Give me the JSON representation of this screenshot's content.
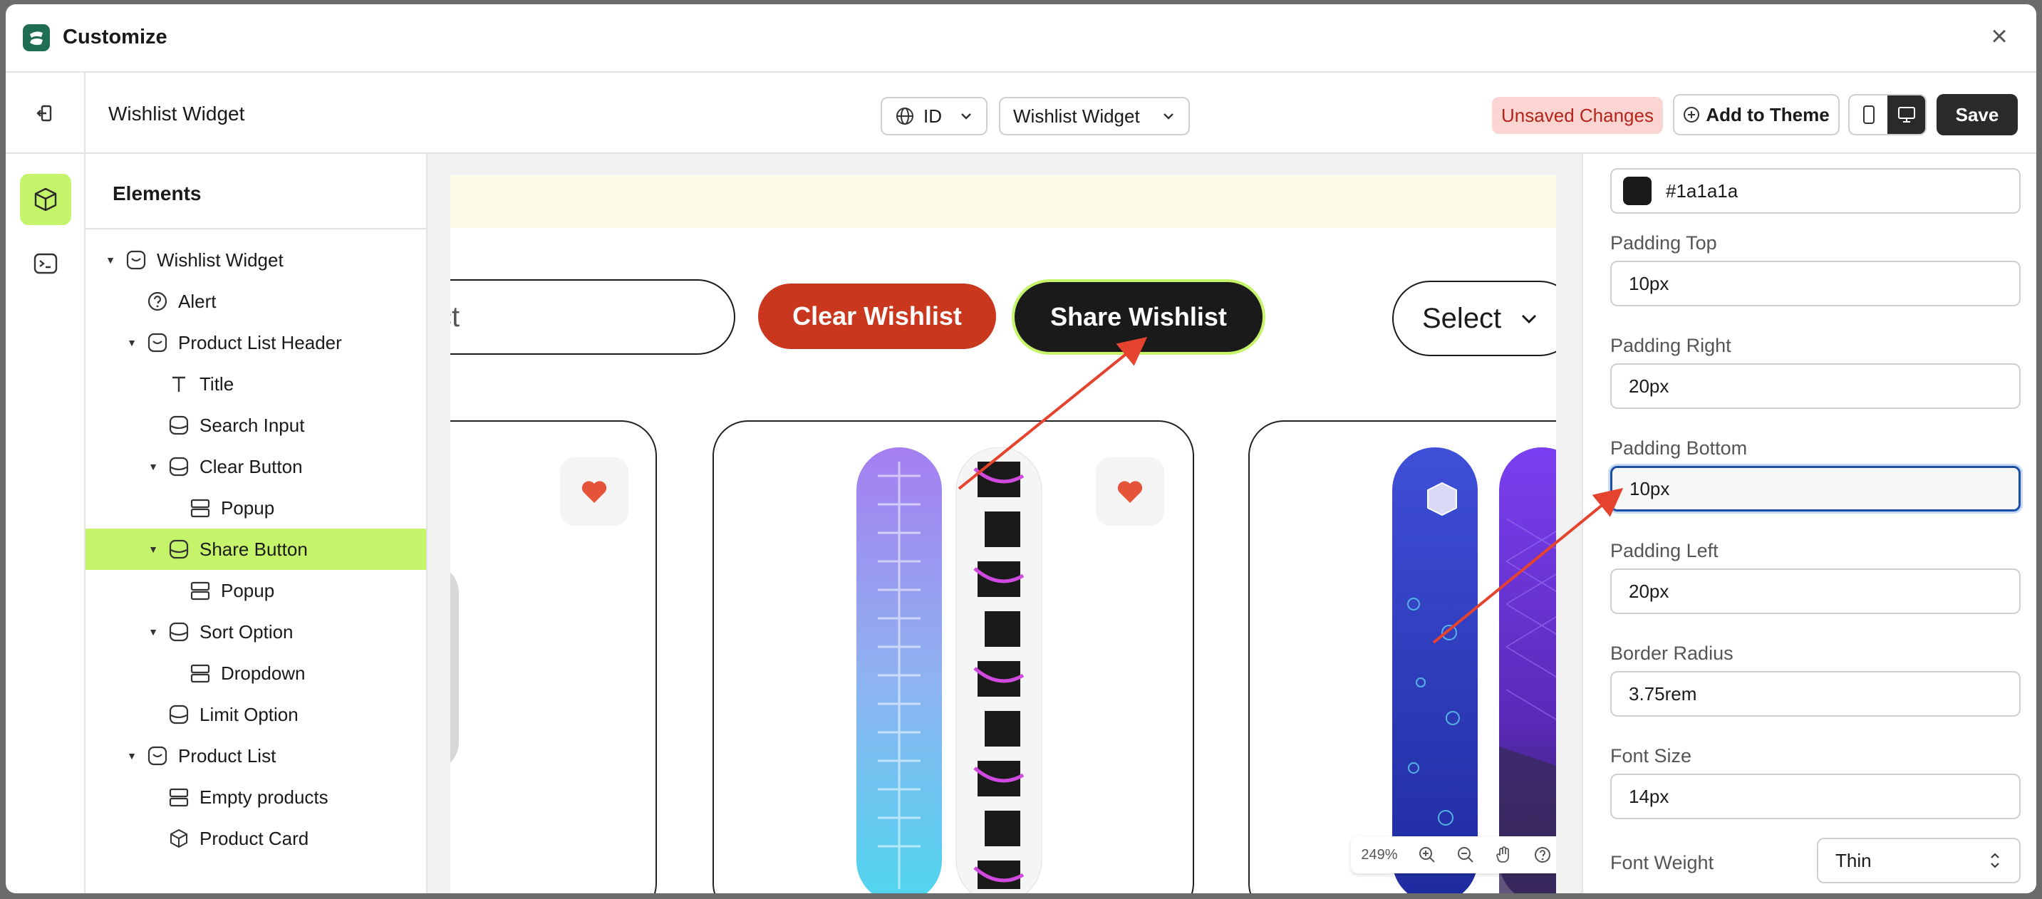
{
  "app": {
    "title": "Customize",
    "logo_icon": "shopify-style-logo-icon",
    "brand_color": "#1f6e52"
  },
  "header": {
    "page_title": "Wishlist Widget",
    "language_select": {
      "value": "ID"
    },
    "widget_select": {
      "value": "Wishlist Widget"
    },
    "unsaved_badge": "Unsaved Changes",
    "add_to_theme_label": "Add to Theme",
    "save_label": "Save"
  },
  "elements_panel": {
    "title": "Elements",
    "tree": [
      {
        "label": "Wishlist Widget",
        "icon": "widget-icon",
        "indent": 0,
        "caret": true
      },
      {
        "label": "Alert",
        "icon": "question-circle-icon",
        "indent": 1,
        "caret": false
      },
      {
        "label": "Product List Header",
        "icon": "widget-icon",
        "indent": 1,
        "caret": true
      },
      {
        "label": "Title",
        "icon": "text-icon",
        "indent": 2,
        "caret": false
      },
      {
        "label": "Search Input",
        "icon": "block-icon",
        "indent": 2,
        "caret": false
      },
      {
        "label": "Clear Button",
        "icon": "block-icon",
        "indent": 2,
        "caret": true
      },
      {
        "label": "Popup",
        "icon": "layout-icon",
        "indent": 3,
        "caret": false
      },
      {
        "label": "Share Button",
        "icon": "block-icon",
        "indent": 2,
        "caret": true,
        "selected": true
      },
      {
        "label": "Popup",
        "icon": "layout-icon",
        "indent": 3,
        "caret": false
      },
      {
        "label": "Sort Option",
        "icon": "block-icon",
        "indent": 2,
        "caret": true
      },
      {
        "label": "Dropdown",
        "icon": "layout-icon",
        "indent": 3,
        "caret": false
      },
      {
        "label": "Limit Option",
        "icon": "block-icon",
        "indent": 2,
        "caret": false
      },
      {
        "label": "Product List",
        "icon": "widget-icon",
        "indent": 1,
        "caret": true
      },
      {
        "label": "Empty products",
        "icon": "layout-icon",
        "indent": 2,
        "caret": false
      },
      {
        "label": "Product Card",
        "icon": "cube-icon",
        "indent": 2,
        "caret": false
      }
    ]
  },
  "preview": {
    "search_placeholder": "ct",
    "clear_button": "Clear Wishlist",
    "share_button": "Share Wishlist",
    "sort_select": "Select",
    "accent_color": "#c5f46a",
    "clear_color": "#c9371f",
    "zoom_level": "249%"
  },
  "settings": {
    "color_value": "#1a1a1a",
    "color_text": "#1a1a1a",
    "fields": [
      {
        "label": "Padding Top",
        "value": "10px"
      },
      {
        "label": "Padding Right",
        "value": "20px"
      },
      {
        "label": "Padding Bottom",
        "value": "10px",
        "focused": true
      },
      {
        "label": "Padding Left",
        "value": "20px"
      },
      {
        "label": "Border Radius",
        "value": "3.75rem"
      },
      {
        "label": "Font Size",
        "value": "14px"
      }
    ],
    "font_weight": {
      "label": "Font Weight",
      "value": "Thin"
    }
  }
}
